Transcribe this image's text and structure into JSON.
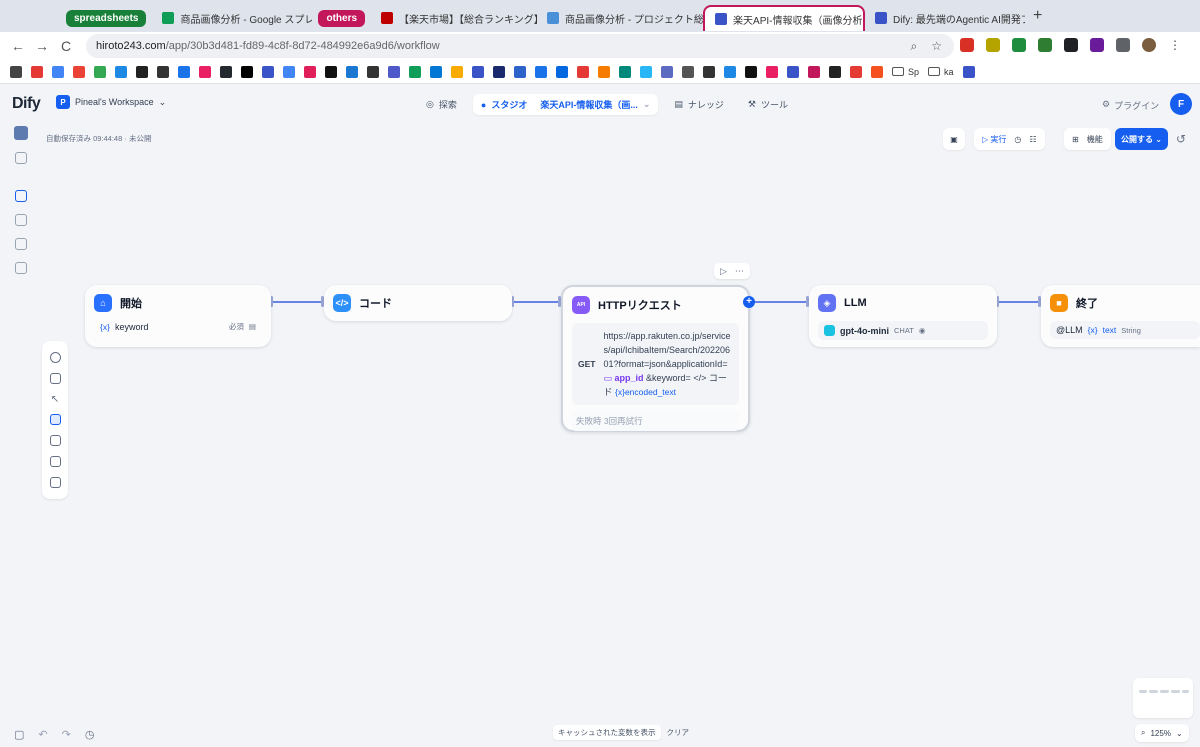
{
  "browser": {
    "tabs": [
      {
        "type": "group",
        "label": "spreadsheets",
        "color": "#188038"
      },
      {
        "label": "商品画像分析 - Google スプレッ",
        "fav": "#0f9d58"
      },
      {
        "type": "group",
        "label": "others",
        "color": "#c2185b"
      },
      {
        "label": "【楽天市場】【総合ランキング】",
        "fav": "#bf0000"
      },
      {
        "label": "商品画像分析 - プロジェクト総覧",
        "fav": "#4a90d9"
      },
      {
        "label": "楽天API-情報収集（画像分析）",
        "fav": "#3a54c8",
        "active": true
      },
      {
        "label": "Dify: 最先端のAgentic AI開発プ",
        "fav": "#3a54c8"
      }
    ],
    "close_glyph": "×",
    "newtab_glyph": "+",
    "nav": {
      "back": "←",
      "forward": "→",
      "reload": "C"
    },
    "url": {
      "host": "hiroto243.com",
      "path": "/app/30b3d481-fd89-4c8f-8d72-484992e6a9d6/workflow"
    },
    "bookmark_folders": [
      "Sp",
      "ka"
    ]
  },
  "app": {
    "logo": "Dify",
    "workspace": {
      "avatar": "P",
      "name": "Pineal's Workspace"
    },
    "nav": {
      "explore": "探索",
      "studio": "スタジオ",
      "current_app": "楽天API-情報収集（画...",
      "knowledge": "ナレッジ",
      "tools": "ツール"
    },
    "plugins": "プラグイン",
    "user_avatar": "F",
    "autosave": "自動保存済み 09:44:48 · 未公開",
    "toolbar": {
      "run": "実行",
      "features": "機能",
      "publish": "公開する"
    }
  },
  "nodes": {
    "start": {
      "title": "開始",
      "var": "keyword",
      "required": "必須"
    },
    "code": {
      "title": "コード"
    },
    "http": {
      "title": "HTTPリクエスト",
      "method": "GET",
      "url_prefix": "https://app.rakuten.co.jp/services/api/IchibaItem/Search/20220601?format=json&applicationId=",
      "var_app_id": "app_id",
      "url_mid": "&keyword=",
      "code_ref": "コード",
      "var_encoded": "encoded_text",
      "retry": "失敗時 3回再試行"
    },
    "llm": {
      "title": "LLM",
      "model": "gpt-4o-mini",
      "mode": "CHAT"
    },
    "end": {
      "title": "終了",
      "source": "@LLM",
      "var": "text",
      "type": "String"
    }
  },
  "bottom": {
    "cache_label": "キャッシュされた変数を表示",
    "clear": "クリア",
    "zoom": "125%"
  },
  "colors": {
    "accent": "#155eef",
    "edge": "#6784e4"
  }
}
